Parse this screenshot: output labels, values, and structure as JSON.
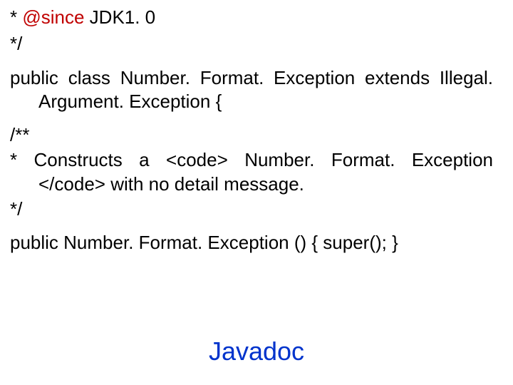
{
  "line1_prefix": " * ",
  "line1_tag": "@since",
  "line1_suffix": " JDK1. 0",
  "line2": " */",
  "para1": "public class Number. Format. Exception extends Illegal. Argument. Exception {",
  "line_open": "/**",
  "comment_body": " * Constructs a <code> Number. Format. Exception </code> with no detail message.",
  "line_close": " */",
  "para2": "public Number. Format. Exception () { super(); }",
  "title": "Javadoc"
}
